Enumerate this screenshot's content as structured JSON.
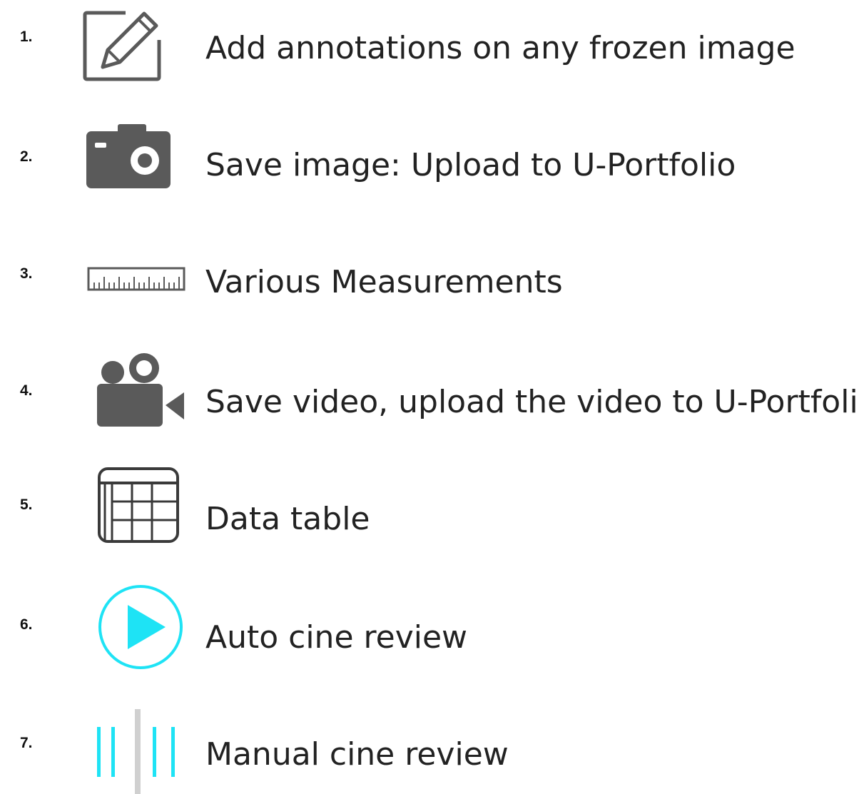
{
  "items": [
    {
      "number": "1.",
      "icon": "pencil-edit-icon",
      "label": "Add annotations on any frozen image"
    },
    {
      "number": "2.",
      "icon": "camera-icon",
      "label": "Save image: Upload to U-Portfolio"
    },
    {
      "number": "3.",
      "icon": "ruler-icon",
      "label": "Various Measurements"
    },
    {
      "number": "4.",
      "icon": "video-camera-icon",
      "label": "Save video, upload the video to U-Portfolio"
    },
    {
      "number": "5.",
      "icon": "data-table-icon",
      "label": "Data table"
    },
    {
      "number": "6.",
      "icon": "play-circle-icon",
      "label": "Auto cine review"
    },
    {
      "number": "7.",
      "icon": "cine-scrubber-icon",
      "label": "Manual cine review"
    }
  ],
  "colors": {
    "icon_gray": "#5a5a5a",
    "accent_cyan": "#1ee3f5",
    "scrubber_gray": "#d0d0d0"
  }
}
